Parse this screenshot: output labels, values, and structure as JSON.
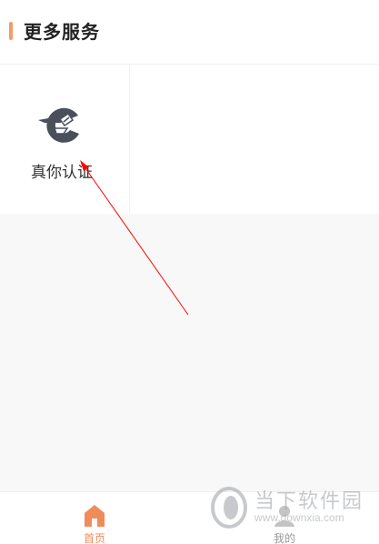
{
  "header": {
    "title": "更多服务",
    "accent_color": "#f29c6b"
  },
  "services": [
    {
      "label": "真你认证",
      "icon": "identity-verification-icon"
    }
  ],
  "tabbar": {
    "active_color": "#f08c5a",
    "inactive_color": "#999999",
    "tabs": [
      {
        "label": "首页",
        "icon": "home-icon",
        "active": true
      },
      {
        "label": "我的",
        "icon": "user-icon",
        "active": false
      }
    ]
  },
  "watermark": {
    "line1": "当下软件园",
    "line2": "www.downxia.com"
  },
  "annotation": {
    "type": "red-arrow",
    "color": "#ff0000"
  }
}
